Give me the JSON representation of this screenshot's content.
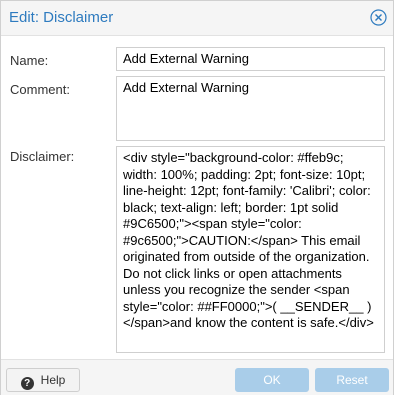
{
  "dialog": {
    "title": "Edit: Disclaimer"
  },
  "form": {
    "name_label": "Name:",
    "name_value": "Add External Warning",
    "comment_label": "Comment:",
    "comment_value": "Add External Warning",
    "disclaimer_label": "Disclaimer:",
    "disclaimer_value": "<div style=\"background-color: #ffeb9c; width: 100%; padding: 2pt; font-size: 10pt; line-height: 12pt; font-family: 'Calibri'; color: black; text-align: left; border: 1pt solid #9C6500;\"><span style=\"color: #9c6500;\">CAUTION:</span> This email originated from outside of the organization. Do not click links or open attachments unless you recognize the sender <span style=\"color: ##FF0000;\">( __SENDER__ )</span>and know the content is safe.</div>"
  },
  "footer": {
    "help_label": "Help",
    "ok_label": "OK",
    "reset_label": "Reset"
  },
  "icons": {
    "close": "close-circle-icon",
    "help": "question-circle-icon"
  },
  "colors": {
    "title": "#2e7bbf",
    "button_disabled": "#a9cde9"
  }
}
